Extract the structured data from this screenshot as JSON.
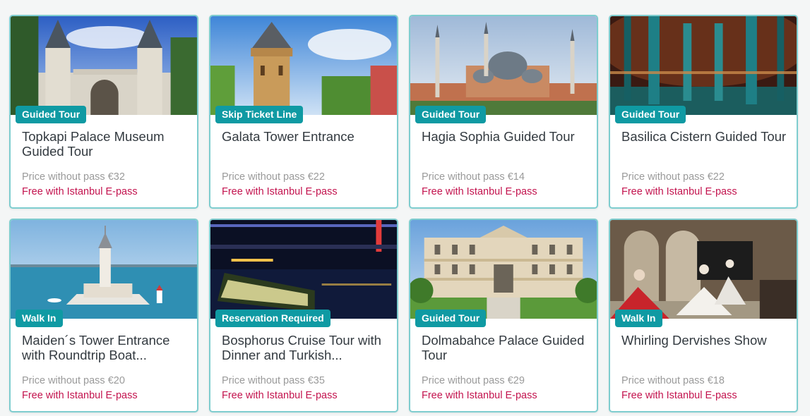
{
  "cards": [
    {
      "badge": "Guided Tour",
      "title": "Topkapi Palace Museum Guided Tour",
      "price": "Price without pass €32",
      "free": "Free with Istanbul E-pass",
      "image": "topkapi-gate"
    },
    {
      "badge": "Skip Ticket Line",
      "title": "Galata Tower Entrance",
      "price": "Price without pass €22",
      "free": "Free with Istanbul E-pass",
      "image": "galata-tower"
    },
    {
      "badge": "Guided Tour",
      "title": "Hagia Sophia Guided Tour",
      "price": "Price without pass €14",
      "free": "Free with Istanbul E-pass",
      "image": "hagia-sophia"
    },
    {
      "badge": "Guided Tour",
      "title": "Basilica Cistern Guided Tour",
      "price": "Price without pass €22",
      "free": "Free with Istanbul E-pass",
      "image": "basilica-cistern"
    },
    {
      "badge": "Walk In",
      "title": "Maiden´s Tower Entrance with Roundtrip Boat...",
      "price": "Price without pass €20",
      "free": "Free with Istanbul E-pass",
      "image": "maidens-tower"
    },
    {
      "badge": "Reservation Required",
      "title": "Bosphorus Cruise Tour with Dinner and Turkish...",
      "price": "Price without pass €35",
      "free": "Free with Istanbul E-pass",
      "image": "bosphorus-night-cruise"
    },
    {
      "badge": "Guided Tour",
      "title": "Dolmabahce Palace Guided Tour",
      "price": "Price without pass €29",
      "free": "Free with Istanbul E-pass",
      "image": "dolmabahce-palace"
    },
    {
      "badge": "Walk In",
      "title": "Whirling Dervishes Show",
      "price": "Price without pass €18",
      "free": "Free with Istanbul E-pass",
      "image": "whirling-dervishes"
    }
  ],
  "colors": {
    "badge": "#0f9aa3",
    "border": "#7ecdcf",
    "free": "#c3134e",
    "price": "#9a9a9a",
    "title": "#333a40"
  }
}
